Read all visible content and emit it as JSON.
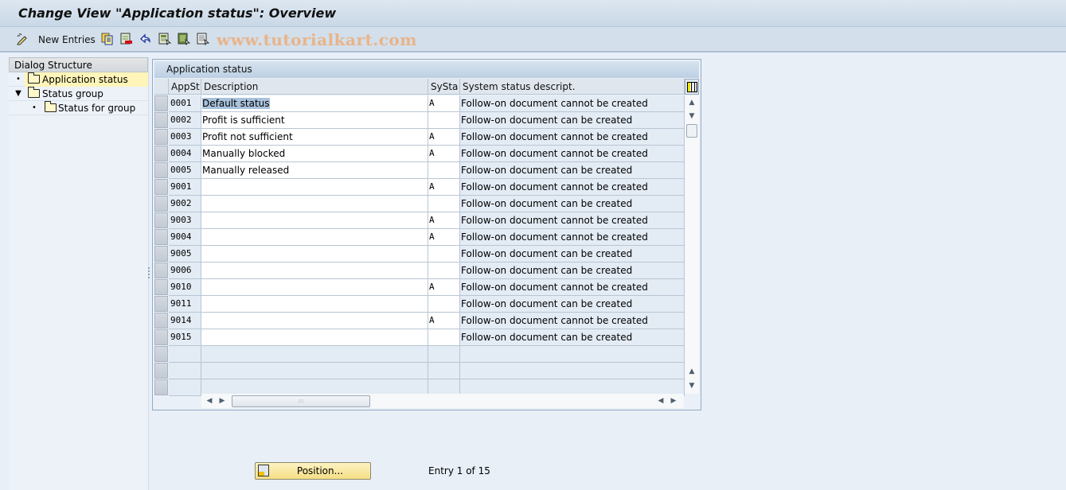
{
  "window": {
    "title": "Change View \"Application status\": Overview"
  },
  "toolbar": {
    "new_entries_label": "New Entries",
    "icons": [
      "edit-pencil-icon",
      "copy-icon",
      "delete-icon",
      "undo-icon",
      "select-all-icon",
      "select-block-icon",
      "deselect-all-icon"
    ],
    "watermark": "www.tutorialkart.com"
  },
  "dialog_structure": {
    "header": "Dialog Structure",
    "items": [
      {
        "label": "Application status",
        "level": 0,
        "selected": true,
        "expander": "•"
      },
      {
        "label": "Status group",
        "level": 0,
        "selected": false,
        "expander": "▼"
      },
      {
        "label": "Status for group",
        "level": 1,
        "selected": false,
        "expander": "•"
      }
    ]
  },
  "table": {
    "caption": "Application status",
    "columns": [
      "AppSt",
      "Description",
      "SySta",
      "System status descript."
    ],
    "rows": [
      {
        "appst": "0001",
        "description": "Default status",
        "systa": "A",
        "sysdesc": "Follow-on document cannot be created"
      },
      {
        "appst": "0002",
        "description": "Profit is sufficient",
        "systa": "",
        "sysdesc": "Follow-on document can be created"
      },
      {
        "appst": "0003",
        "description": "Profit not sufficient",
        "systa": "A",
        "sysdesc": "Follow-on document cannot be created"
      },
      {
        "appst": "0004",
        "description": "Manually blocked",
        "systa": "A",
        "sysdesc": "Follow-on document cannot be created"
      },
      {
        "appst": "0005",
        "description": "Manually released",
        "systa": "",
        "sysdesc": "Follow-on document can be created"
      },
      {
        "appst": "9001",
        "description": "",
        "systa": "A",
        "sysdesc": "Follow-on document cannot be created"
      },
      {
        "appst": "9002",
        "description": "",
        "systa": "",
        "sysdesc": "Follow-on document can be created"
      },
      {
        "appst": "9003",
        "description": "",
        "systa": "A",
        "sysdesc": "Follow-on document cannot be created"
      },
      {
        "appst": "9004",
        "description": "",
        "systa": "A",
        "sysdesc": "Follow-on document cannot be created"
      },
      {
        "appst": "9005",
        "description": "",
        "systa": "",
        "sysdesc": "Follow-on document can be created"
      },
      {
        "appst": "9006",
        "description": "",
        "systa": "",
        "sysdesc": "Follow-on document can be created"
      },
      {
        "appst": "9010",
        "description": "",
        "systa": "A",
        "sysdesc": "Follow-on document cannot be created"
      },
      {
        "appst": "9011",
        "description": "",
        "systa": "",
        "sysdesc": "Follow-on document can be created"
      },
      {
        "appst": "9014",
        "description": "",
        "systa": "A",
        "sysdesc": "Follow-on document cannot be created"
      },
      {
        "appst": "9015",
        "description": "",
        "systa": "",
        "sysdesc": "Follow-on document can be created"
      }
    ],
    "empty_rows": 3
  },
  "footer": {
    "position_button": "Position...",
    "entry_info": "Entry 1 of 15"
  }
}
